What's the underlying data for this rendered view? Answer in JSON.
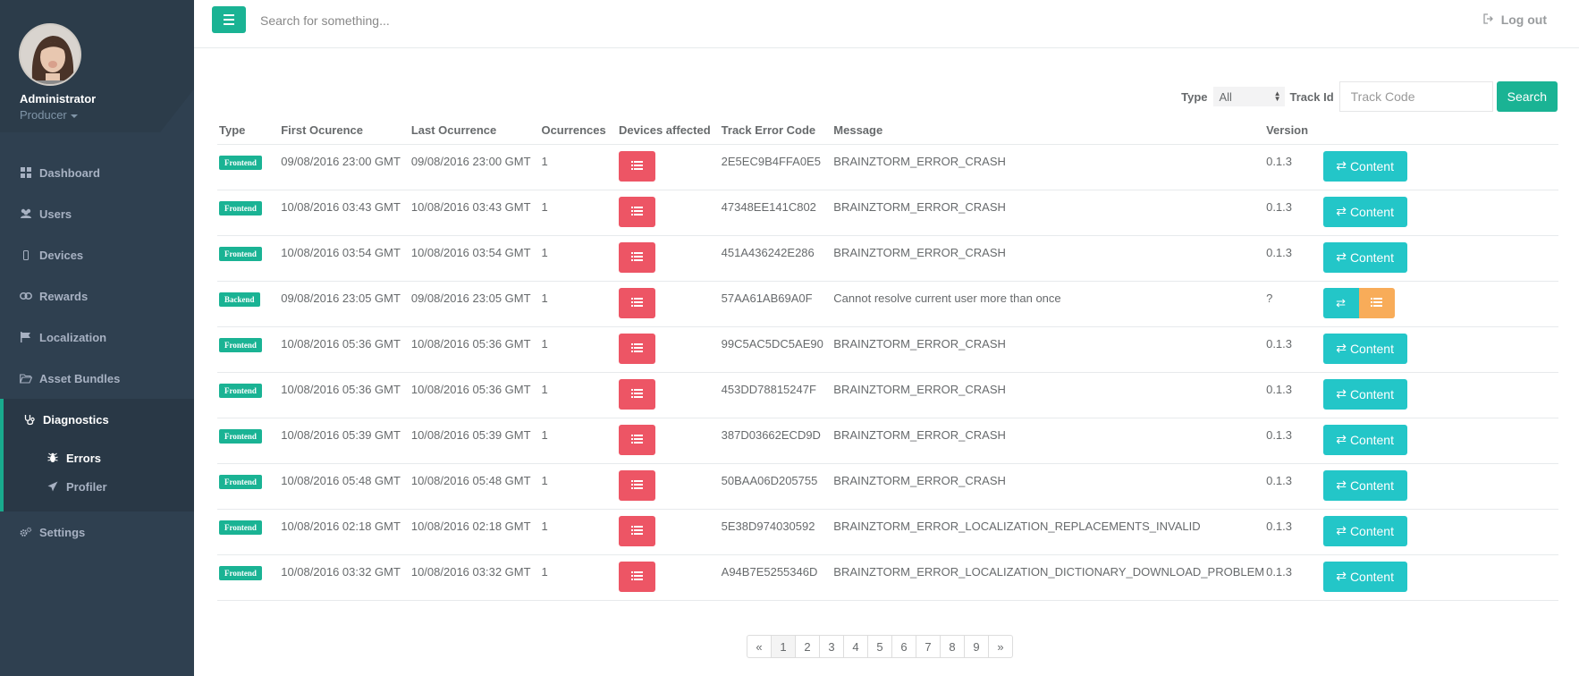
{
  "profile": {
    "name": "Administrator",
    "role": "Producer"
  },
  "sidebar": {
    "items": [
      {
        "label": "Dashboard",
        "icon": "dashboard-icon"
      },
      {
        "label": "Users",
        "icon": "users-icon"
      },
      {
        "label": "Devices",
        "icon": "mobile-icon"
      },
      {
        "label": "Rewards",
        "icon": "link-icon"
      },
      {
        "label": "Localization",
        "icon": "flag-icon"
      },
      {
        "label": "Asset Bundles",
        "icon": "folder-icon"
      },
      {
        "label": "Diagnostics",
        "icon": "stethoscope-icon",
        "active": true
      },
      {
        "label": "Settings",
        "icon": "cogs-icon"
      }
    ],
    "subitems": [
      {
        "label": "Errors",
        "icon": "bug-icon",
        "active": true
      },
      {
        "label": "Profiler",
        "icon": "paper-plane-icon"
      }
    ]
  },
  "topbar": {
    "search_placeholder": "Search for something...",
    "logout": "Log out"
  },
  "filter": {
    "type_label": "Type",
    "type_value": "All",
    "trackid_label": "Track Id",
    "track_placeholder": "Track Code",
    "search_button": "Search"
  },
  "table": {
    "headers": [
      "Type",
      "First Ocurence",
      "Last Ocurrence",
      "Ocurrences",
      "Devices affected",
      "Track Error Code",
      "Message",
      "Version",
      ""
    ],
    "content_label": "Content",
    "rows": [
      {
        "type": "Frontend",
        "first": "09/08/2016 23:00 GMT",
        "last": "09/08/2016 23:00 GMT",
        "count": "1",
        "code": "2E5EC9B4FFA0E5",
        "message": "BRAINZTORM_ERROR_CRASH",
        "version": "0.1.3"
      },
      {
        "type": "Frontend",
        "first": "10/08/2016 03:43 GMT",
        "last": "10/08/2016 03:43 GMT",
        "count": "1",
        "code": "47348EE141C802",
        "message": "BRAINZTORM_ERROR_CRASH",
        "version": "0.1.3"
      },
      {
        "type": "Frontend",
        "first": "10/08/2016 03:54 GMT",
        "last": "10/08/2016 03:54 GMT",
        "count": "1",
        "code": "451A436242E286",
        "message": "BRAINZTORM_ERROR_CRASH",
        "version": "0.1.3"
      },
      {
        "type": "Backend",
        "first": "09/08/2016 23:05 GMT",
        "last": "09/08/2016 23:05 GMT",
        "count": "1",
        "code": "57AA61AB69A0F",
        "message": "Cannot resolve current user more than once",
        "version": "?"
      },
      {
        "type": "Frontend",
        "first": "10/08/2016 05:36 GMT",
        "last": "10/08/2016 05:36 GMT",
        "count": "1",
        "code": "99C5AC5DC5AE90",
        "message": "BRAINZTORM_ERROR_CRASH",
        "version": "0.1.3"
      },
      {
        "type": "Frontend",
        "first": "10/08/2016 05:36 GMT",
        "last": "10/08/2016 05:36 GMT",
        "count": "1",
        "code": "453DD78815247F",
        "message": "BRAINZTORM_ERROR_CRASH",
        "version": "0.1.3"
      },
      {
        "type": "Frontend",
        "first": "10/08/2016 05:39 GMT",
        "last": "10/08/2016 05:39 GMT",
        "count": "1",
        "code": "387D03662ECD9D",
        "message": "BRAINZTORM_ERROR_CRASH",
        "version": "0.1.3"
      },
      {
        "type": "Frontend",
        "first": "10/08/2016 05:48 GMT",
        "last": "10/08/2016 05:48 GMT",
        "count": "1",
        "code": "50BAA06D205755",
        "message": "BRAINZTORM_ERROR_CRASH",
        "version": "0.1.3"
      },
      {
        "type": "Frontend",
        "first": "10/08/2016 02:18 GMT",
        "last": "10/08/2016 02:18 GMT",
        "count": "1",
        "code": "5E38D974030592",
        "message": "BRAINZTORM_ERROR_LOCALIZATION_REPLACEMENTS_INVALID",
        "version": "0.1.3"
      },
      {
        "type": "Frontend",
        "first": "10/08/2016 03:32 GMT",
        "last": "10/08/2016 03:32 GMT",
        "count": "1",
        "code": "A94B7E5255346D",
        "message": "BRAINZTORM_ERROR_LOCALIZATION_DICTIONARY_DOWNLOAD_PROBLEM",
        "version": "0.1.3"
      }
    ]
  },
  "pagination": {
    "prev": "«",
    "pages": [
      "1",
      "2",
      "3",
      "4",
      "5",
      "6",
      "7",
      "8",
      "9"
    ],
    "next": "»",
    "active": "1"
  },
  "colors": {
    "sidebar": "#2f4050",
    "primary": "#1ab394",
    "danger": "#ed5565",
    "info": "#23c6c8",
    "warning": "#f8ac59"
  }
}
